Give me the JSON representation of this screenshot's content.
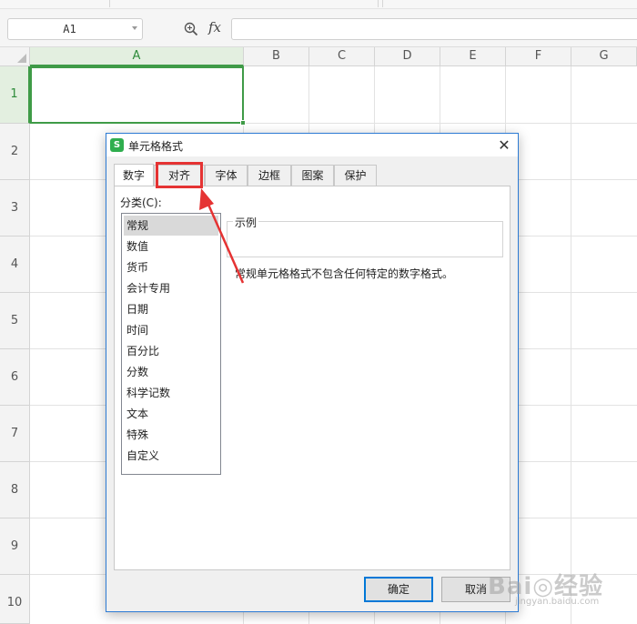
{
  "formula_bar": {
    "name_box_value": "A1",
    "fx_label": "fx",
    "formula_value": ""
  },
  "grid": {
    "columns": [
      "A",
      "B",
      "C",
      "D",
      "E",
      "F",
      "G"
    ],
    "rows": [
      "1",
      "2",
      "3",
      "4",
      "5",
      "6",
      "7",
      "8",
      "9",
      "10"
    ],
    "selected_cell": "A1",
    "accent_color": "#3f9b47"
  },
  "dialog": {
    "title": "单元格格式",
    "logo_glyph": "S",
    "close_glyph": "✕",
    "tabs": [
      "数字",
      "对齐",
      "字体",
      "边框",
      "图案",
      "保护"
    ],
    "active_tab": "数字",
    "category_label": "分类(C):",
    "categories": [
      "常规",
      "数值",
      "货币",
      "会计专用",
      "日期",
      "时间",
      "百分比",
      "分数",
      "科学记数",
      "文本",
      "特殊",
      "自定义"
    ],
    "selected_category": "常规",
    "sample_label": "示例",
    "description": "常规单元格格式不包含任何特定的数字格式。",
    "ok_label": "确定",
    "cancel_label": "取消"
  },
  "annotation": {
    "highlight_color": "#e53333",
    "highlighted_tab": "对齐"
  },
  "watermark": {
    "main": "Bai◎经验",
    "sub": "jingyan.baidu.com"
  }
}
